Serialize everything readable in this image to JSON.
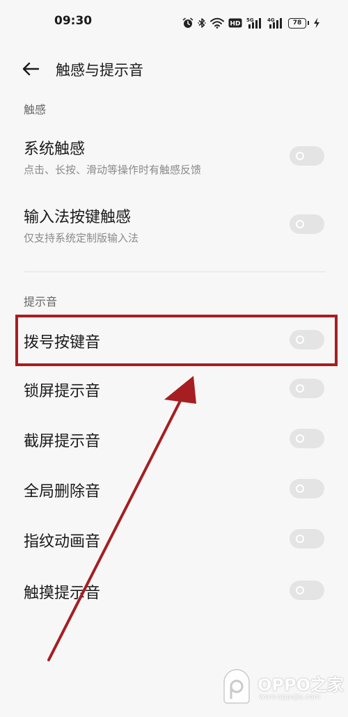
{
  "status_bar": {
    "time": "09:30",
    "hd_label": "HD",
    "sim1_label": "5G",
    "sim2_label": "4G",
    "battery": "78",
    "icons": [
      "alarm-icon",
      "bluetooth-icon",
      "wifi-icon",
      "hd-icon",
      "signal-5g-icon",
      "signal-4g-icon",
      "battery-icon",
      "charging-icon"
    ]
  },
  "header": {
    "title": "触感与提示音",
    "back_icon": "back-arrow-icon"
  },
  "sections": {
    "haptics": {
      "label": "触感",
      "items": [
        {
          "title": "系统触感",
          "subtitle": "点击、长按、滑动等操作时有触感反馈",
          "enabled": false
        },
        {
          "title": "输入法按键触感",
          "subtitle": "仅支持系统定制版输入法",
          "enabled": false
        }
      ]
    },
    "sounds": {
      "label": "提示音",
      "items": [
        {
          "title": "拨号按键音",
          "enabled": false
        },
        {
          "title": "锁屏提示音",
          "enabled": false
        },
        {
          "title": "截屏提示音",
          "enabled": false
        },
        {
          "title": "全局删除音",
          "enabled": false
        },
        {
          "title": "指纹动画音",
          "enabled": false
        },
        {
          "title": "触摸提示音",
          "enabled": false
        }
      ]
    }
  },
  "annotation": {
    "color": "#a61e22"
  },
  "watermark": {
    "text": "OPPO之家",
    "url": "www.oppojia.com"
  }
}
